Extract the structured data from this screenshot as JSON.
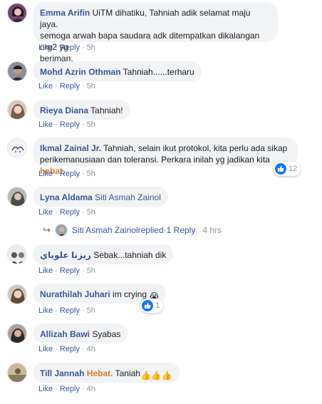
{
  "colors": {
    "link": "#385898",
    "highlight": "#e07b27",
    "bubble": "#f2f3f5",
    "muted": "#90949c",
    "like": "#1877f2"
  },
  "actions": {
    "like": "Like",
    "reply": "Reply",
    "dot": "·"
  },
  "comments": [
    {
      "author": "Emma Arifin",
      "text_line1": " UiTM dihatiku, Tahniah adik selamat maju jaya.",
      "text_line2": "semoga arwah bapa saudara adk ditempatkan dikalangan org2 yg",
      "text_line3": "beriman.",
      "time": "5h"
    },
    {
      "author": "Mohd Azrin Othman",
      "text": " Tahniah......terharu",
      "time": "5h"
    },
    {
      "author": "Rieya Diana",
      "text": " Tahniah!",
      "time": "5h"
    },
    {
      "author": "Ikmal Zainal Jr.",
      "text_line1": " Tahniah, selain ikut protokol, kita perlu ada sikap",
      "text_line2_pre": "perikemanusiaan dan toleransi. Perkara inilah yg jadikan kita ",
      "text_highlight": "hebat",
      "text_line2_post": ".",
      "time": "5h",
      "reactions": "12"
    },
    {
      "author": "Lyna Aldama",
      "tag": " Siti Asmah Zainol",
      "time": "5h"
    },
    {
      "author": "ريزنا علوياي",
      "text": " Sebak...tahniah dik",
      "time": "5h"
    },
    {
      "author": "Nurathilah Juhari",
      "text": " im crying ",
      "emoji": "😭",
      "time": "5h",
      "reactions": "1"
    },
    {
      "author": "Allizah Bawi",
      "text": " Syabas",
      "time": "4h"
    },
    {
      "author": "Till Jannah",
      "highlight": " Hebat",
      "text": ". Taniah",
      "emoji": "👍👍👍",
      "time": "4h"
    }
  ],
  "reply_summary": {
    "arrow": "↪",
    "name": "Siti Asmah Zainol",
    "verb": " replied",
    "dot": " · ",
    "link": "1 Reply",
    "time": "4 hrs"
  }
}
